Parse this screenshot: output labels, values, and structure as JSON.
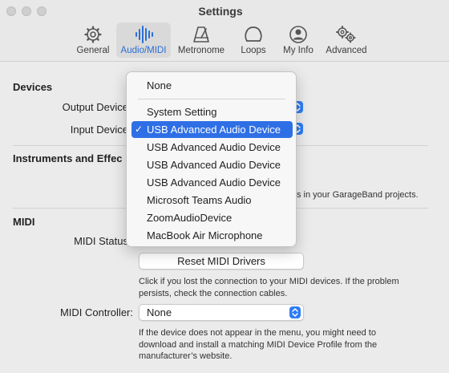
{
  "window": {
    "title": "Settings"
  },
  "toolbar": {
    "tabs": [
      {
        "label": "General",
        "icon": "gear-icon"
      },
      {
        "label": "Audio/MIDI",
        "icon": "audio-waveform-icon",
        "active": true
      },
      {
        "label": "Metronome",
        "icon": "metronome-icon"
      },
      {
        "label": "Loops",
        "icon": "loops-icon"
      },
      {
        "label": "My Info",
        "icon": "person-icon"
      },
      {
        "label": "Advanced",
        "icon": "gears-icon"
      }
    ]
  },
  "devices": {
    "heading": "Devices",
    "output_label": "Output Device",
    "input_label": "Input Device"
  },
  "instruments": {
    "heading": "Instruments and Effec",
    "description_tail": "s in your GarageBand projects."
  },
  "midi": {
    "heading": "MIDI",
    "status_label": "MIDI Status",
    "reset_button": "Reset MIDI Drivers",
    "reset_help": "Click if you lost the connection to your MIDI devices. If the problem persists, check the connection cables.",
    "controller_label": "MIDI Controller:",
    "controller_value": "None",
    "controller_help": "If the device does not appear in the menu, you might need to download and install a matching MIDI Device Profile from the manufacturer’s website."
  },
  "input_menu": {
    "items": [
      "None",
      "System Setting",
      "USB Advanced Audio Device",
      "USB Advanced Audio Device",
      "USB Advanced Audio Device",
      "USB Advanced Audio Device",
      "Microsoft Teams Audio",
      "ZoomAudioDevice",
      "MacBook Air Microphone"
    ],
    "selected": "USB Advanced Audio Device",
    "check": "✓"
  },
  "colors": {
    "accent": "#2f6fe6",
    "stepper": "#2f7df6",
    "active_tab_text": "#2a6fd6"
  }
}
